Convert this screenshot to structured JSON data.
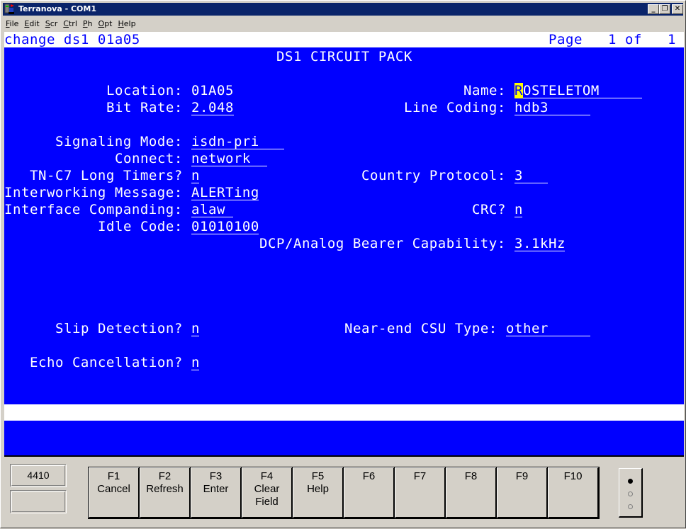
{
  "window": {
    "title": "Terranova - COM1",
    "controls": {
      "minimize": "_",
      "restore": "❐",
      "close": "✕"
    }
  },
  "menu": [
    {
      "label": "File",
      "accel": "F"
    },
    {
      "label": "Edit",
      "accel": "E"
    },
    {
      "label": "Scr",
      "accel": "S"
    },
    {
      "label": "Ctrl",
      "accel": "C"
    },
    {
      "label": "Ph",
      "accel": "P"
    },
    {
      "label": "Opt",
      "accel": "O"
    },
    {
      "label": "Help",
      "accel": "H"
    }
  ],
  "terminal": {
    "command": "change ds1 01a05",
    "page_label": "Page",
    "page_current": "1",
    "page_of": "of",
    "page_total": "1",
    "form_title": "DS1 CIRCUIT PACK",
    "fields": {
      "location": {
        "label": "Location:",
        "value": "01A05"
      },
      "name": {
        "label": "Name:",
        "cursor_char": "R",
        "value_rest": "OSTELETOM"
      },
      "bit_rate": {
        "label": "Bit Rate:",
        "value": "2.048"
      },
      "line_coding": {
        "label": "Line Coding:",
        "value": "hdb3"
      },
      "signaling_mode": {
        "label": "Signaling Mode:",
        "value": "isdn-pri"
      },
      "connect": {
        "label": "Connect:",
        "value": "network"
      },
      "tn_c7_long_timers": {
        "label": "TN-C7 Long Timers?",
        "value": "n"
      },
      "country_protocol": {
        "label": "Country Protocol:",
        "value": "3"
      },
      "interworking_message": {
        "label": "Interworking Message:",
        "value": "ALERTing"
      },
      "interface_companding": {
        "label": "Interface Companding:",
        "value": "alaw"
      },
      "crc": {
        "label": "CRC?",
        "value": "n"
      },
      "idle_code": {
        "label": "Idle Code:",
        "value": "01010100"
      },
      "dcp_bearer": {
        "label": "DCP/Analog Bearer Capability:",
        "value": "3.1kHz"
      },
      "slip_detection": {
        "label": "Slip Detection?",
        "value": "n"
      },
      "near_end_csu": {
        "label": "Near-end CSU Type:",
        "value": "other"
      },
      "echo_cancellation": {
        "label": "Echo Cancellation?",
        "value": "n"
      }
    }
  },
  "status": {
    "terminal_type": "4410",
    "secondary": ""
  },
  "function_keys": [
    {
      "key": "F1",
      "line1": "Cancel",
      "line2": ""
    },
    {
      "key": "F2",
      "line1": "Refresh",
      "line2": ""
    },
    {
      "key": "F3",
      "line1": "Enter",
      "line2": ""
    },
    {
      "key": "F4",
      "line1": "Clear",
      "line2": "Field"
    },
    {
      "key": "F5",
      "line1": "Help",
      "line2": ""
    },
    {
      "key": "F6",
      "line1": "",
      "line2": ""
    },
    {
      "key": "F7",
      "line1": "",
      "line2": ""
    },
    {
      "key": "F8",
      "line1": "",
      "line2": ""
    },
    {
      "key": "F9",
      "line1": "",
      "line2": ""
    },
    {
      "key": "F10",
      "line1": "",
      "line2": ""
    }
  ],
  "colors": {
    "screen_bg": "#0000ff",
    "screen_fg": "#ffffff",
    "cursor": "#ffff00",
    "titlebar": "#0a246a"
  }
}
